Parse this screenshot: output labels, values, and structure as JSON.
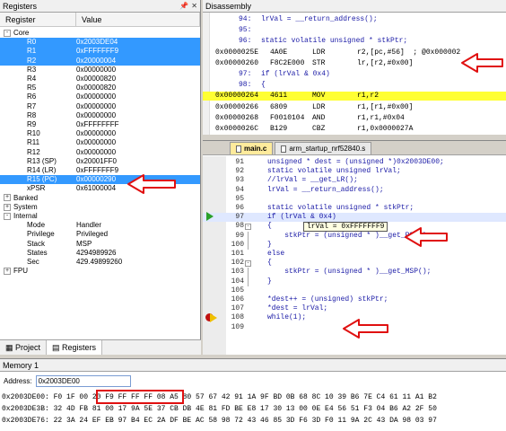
{
  "registers": {
    "title": "Registers",
    "columns": [
      "Register",
      "Value"
    ],
    "core_label": "Core",
    "rows": [
      {
        "name": "R0",
        "value": "0x2003DE04",
        "sel": true
      },
      {
        "name": "R1",
        "value": "0xFFFFFFF9",
        "sel": true
      },
      {
        "name": "R2",
        "value": "0x20000004",
        "sel": true
      },
      {
        "name": "R3",
        "value": "0x00000000",
        "sel": false
      },
      {
        "name": "R4",
        "value": "0x00000820",
        "sel": false
      },
      {
        "name": "R5",
        "value": "0x00000820",
        "sel": false
      },
      {
        "name": "R6",
        "value": "0x00000000",
        "sel": false
      },
      {
        "name": "R7",
        "value": "0x00000000",
        "sel": false
      },
      {
        "name": "R8",
        "value": "0x00000000",
        "sel": false
      },
      {
        "name": "R9",
        "value": "0xFFFFFFFF",
        "sel": false
      },
      {
        "name": "R10",
        "value": "0x00000000",
        "sel": false
      },
      {
        "name": "R11",
        "value": "0x00000000",
        "sel": false
      },
      {
        "name": "R12",
        "value": "0x00000000",
        "sel": false
      },
      {
        "name": "R13 (SP)",
        "value": "0x20001FF0",
        "sel": false
      },
      {
        "name": "R14 (LR)",
        "value": "0xFFFFFFF9",
        "sel": false
      },
      {
        "name": "R15 (PC)",
        "value": "0x00000290",
        "sel": true
      },
      {
        "name": "xPSR",
        "value": "0x61000004",
        "sel": false
      }
    ],
    "groups": [
      "Banked",
      "System"
    ],
    "internal": {
      "label": "Internal",
      "items": [
        {
          "name": "Mode",
          "value": "Handler"
        },
        {
          "name": "Privilege",
          "value": "Privileged"
        },
        {
          "name": "Stack",
          "value": "MSP"
        },
        {
          "name": "States",
          "value": "4294989926"
        },
        {
          "name": "Sec",
          "value": "429.49899260"
        }
      ]
    },
    "fpu_label": "FPU",
    "tabs": [
      "Project",
      "Registers"
    ]
  },
  "disassembly": {
    "title": "Disassembly",
    "lines": [
      {
        "kind": "src",
        "num": "94:",
        "text": "lrVal = __return_address();"
      },
      {
        "kind": "src",
        "num": "95:",
        "text": ""
      },
      {
        "kind": "src",
        "num": "96:",
        "text": "static volatile unsigned * stkPtr;"
      },
      {
        "kind": "asm",
        "addr": "0x0000025E",
        "hex": "4A0E",
        "mn": "LDR",
        "ops": "r2,[pc,#56]  ; @0x000002"
      },
      {
        "kind": "asm",
        "addr": "0x00000260",
        "hex": "F8C2E000",
        "mn": "STR",
        "ops": "lr,[r2,#0x00]"
      },
      {
        "kind": "src",
        "num": "97:",
        "text": "if (lrVal & 0x4)"
      },
      {
        "kind": "src",
        "num": "98:",
        "text": "{"
      },
      {
        "kind": "asm",
        "addr": "0x00000264",
        "hex": "4611",
        "mn": "MOV",
        "ops": "r1,r2",
        "hl": true
      },
      {
        "kind": "asm",
        "addr": "0x00000266",
        "hex": "6809",
        "mn": "LDR",
        "ops": "r1,[r1,#0x00]"
      },
      {
        "kind": "asm",
        "addr": "0x00000268",
        "hex": "F0010104",
        "mn": "AND",
        "ops": "r1,r1,#0x04"
      },
      {
        "kind": "asm",
        "addr": "0x0000026C",
        "hex": "B129",
        "mn": "CBZ",
        "ops": "r1,0x0000027A"
      }
    ]
  },
  "editor": {
    "tabs": [
      "main.c",
      "arm_startup_nrf52840.s"
    ],
    "lines": [
      {
        "n": "91",
        "t": "unsigned * dest = (unsigned *)0x2003DE00;"
      },
      {
        "n": "92",
        "t": "static volatile unsigned lrVal;"
      },
      {
        "n": "93",
        "t": "//lrVal = __get_LR();"
      },
      {
        "n": "94",
        "t": "lrVal = __return_address();"
      },
      {
        "n": "95",
        "t": ""
      },
      {
        "n": "96",
        "t": "static volatile unsigned * stkPtr;"
      },
      {
        "n": "97",
        "t": "if (lrVal & 0x4)"
      },
      {
        "n": "98",
        "t": "{"
      },
      {
        "n": "99",
        "t": "    stkPtr = (unsigned * )__get_PSP();"
      },
      {
        "n": "100",
        "t": "}"
      },
      {
        "n": "101",
        "t": "else"
      },
      {
        "n": "102",
        "t": "{"
      },
      {
        "n": "103",
        "t": "    stkPtr = (unsigned * )__get_MSP();"
      },
      {
        "n": "104",
        "t": "}"
      },
      {
        "n": "105",
        "t": ""
      },
      {
        "n": "106",
        "t": "*dest++ = (unsigned) stkPtr;"
      },
      {
        "n": "107",
        "t": "*dest = lrVal;"
      },
      {
        "n": "108",
        "t": "while(1);"
      },
      {
        "n": "109",
        "t": ""
      }
    ],
    "tooltip": "lrVal = 0xFFFFFFF9"
  },
  "memory": {
    "title": "Memory 1",
    "address_label": "Address:",
    "address_value": "0x2003DE00",
    "rows": [
      "0x2003DE00: F0 1F 00 20 F9 FF FF FF 08 A5 80 57 67 42 91 1A 9F BD 0B 68 8C 10 39 B6 7E C4 61 11 A1 B2",
      "0x2003DE3B: 32 4D FB 81 00 17 9A 5E 37 CB DB 4E 81 FD BE E8 17 30 13 00 0E E4 56 51 F3 04 B6 A2 2F 50",
      "0x2003DE76: 22 3A 24 EF EB 97 B4 EC 2A DF BE AC 58 98 72 43 46 85 3D F6 3D F0 11 9A 2C 43 DA 98 03 97"
    ]
  },
  "colors": {
    "selection": "#3399ff",
    "highlight": "#ffff33",
    "annotation": "#e01010"
  }
}
